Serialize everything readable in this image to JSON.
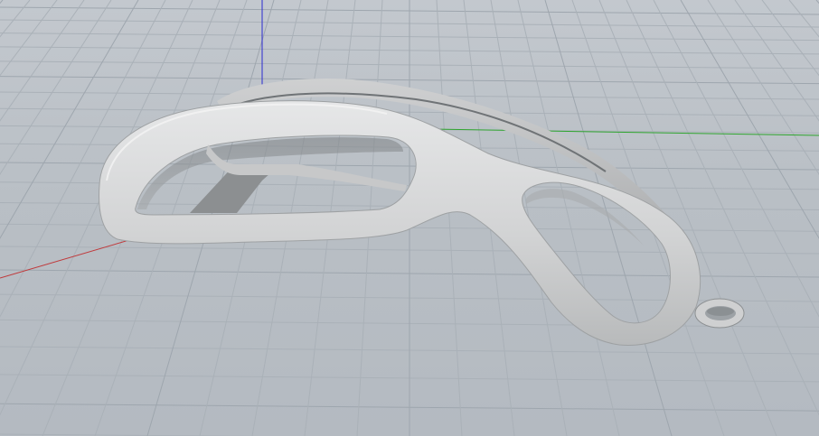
{
  "viewport": {
    "background_color": "#b9bfc6",
    "grid_minor_color": "#aab1b8",
    "grid_major_color": "#9ea6ae",
    "axes": {
      "x_color": "#c0393b",
      "y_color": "#2fa52f",
      "z_color": "#2b2bd0"
    },
    "model": {
      "type": "clip-shaped 3D part",
      "material_color": "#d4d5d6",
      "shadow_color": "#8e9193"
    }
  }
}
